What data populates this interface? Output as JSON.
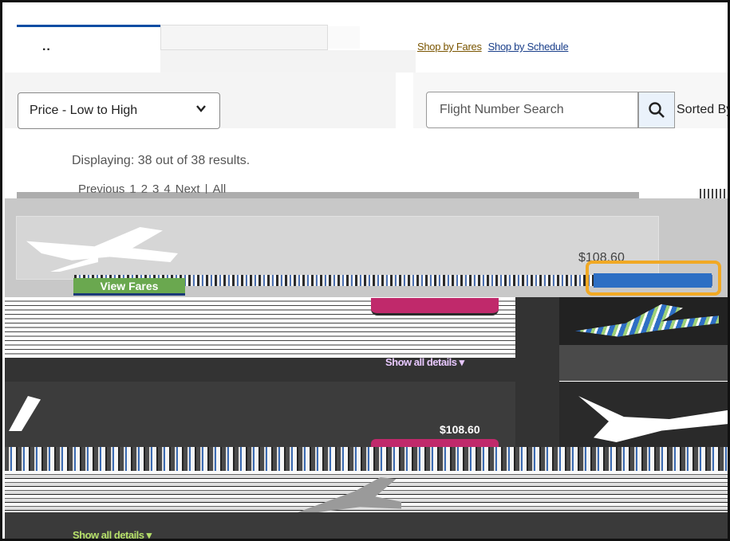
{
  "tabs": {
    "active_tab_glyph": "··",
    "shop_links": [
      "Shop by Fares",
      "Shop by Schedule"
    ]
  },
  "filters": {
    "sort_value": "Price - Low to High",
    "flight_search_placeholder": "Flight Number Search",
    "sorted_by_label": "Sorted By"
  },
  "results": {
    "count_text": "Displaying: 38 out of 38 results.",
    "pager": [
      "Previous",
      "1",
      "2",
      "3",
      "4",
      "Next",
      "|",
      "All"
    ]
  },
  "cards": [
    {
      "price": "$108.60",
      "view_fares_label": "View Fares",
      "show_details_label": "Show all details ▾"
    },
    {
      "price": "$108.60",
      "show_details_label": "Show all details ▾"
    }
  ],
  "colors": {
    "primary_blue": "#0a4da3",
    "fares_green": "#6aa84f",
    "select_highlight": "#f1a924",
    "magenta": "#c0296b"
  },
  "icons": {
    "search": "search-icon",
    "chevron": "chevron-down-icon"
  }
}
